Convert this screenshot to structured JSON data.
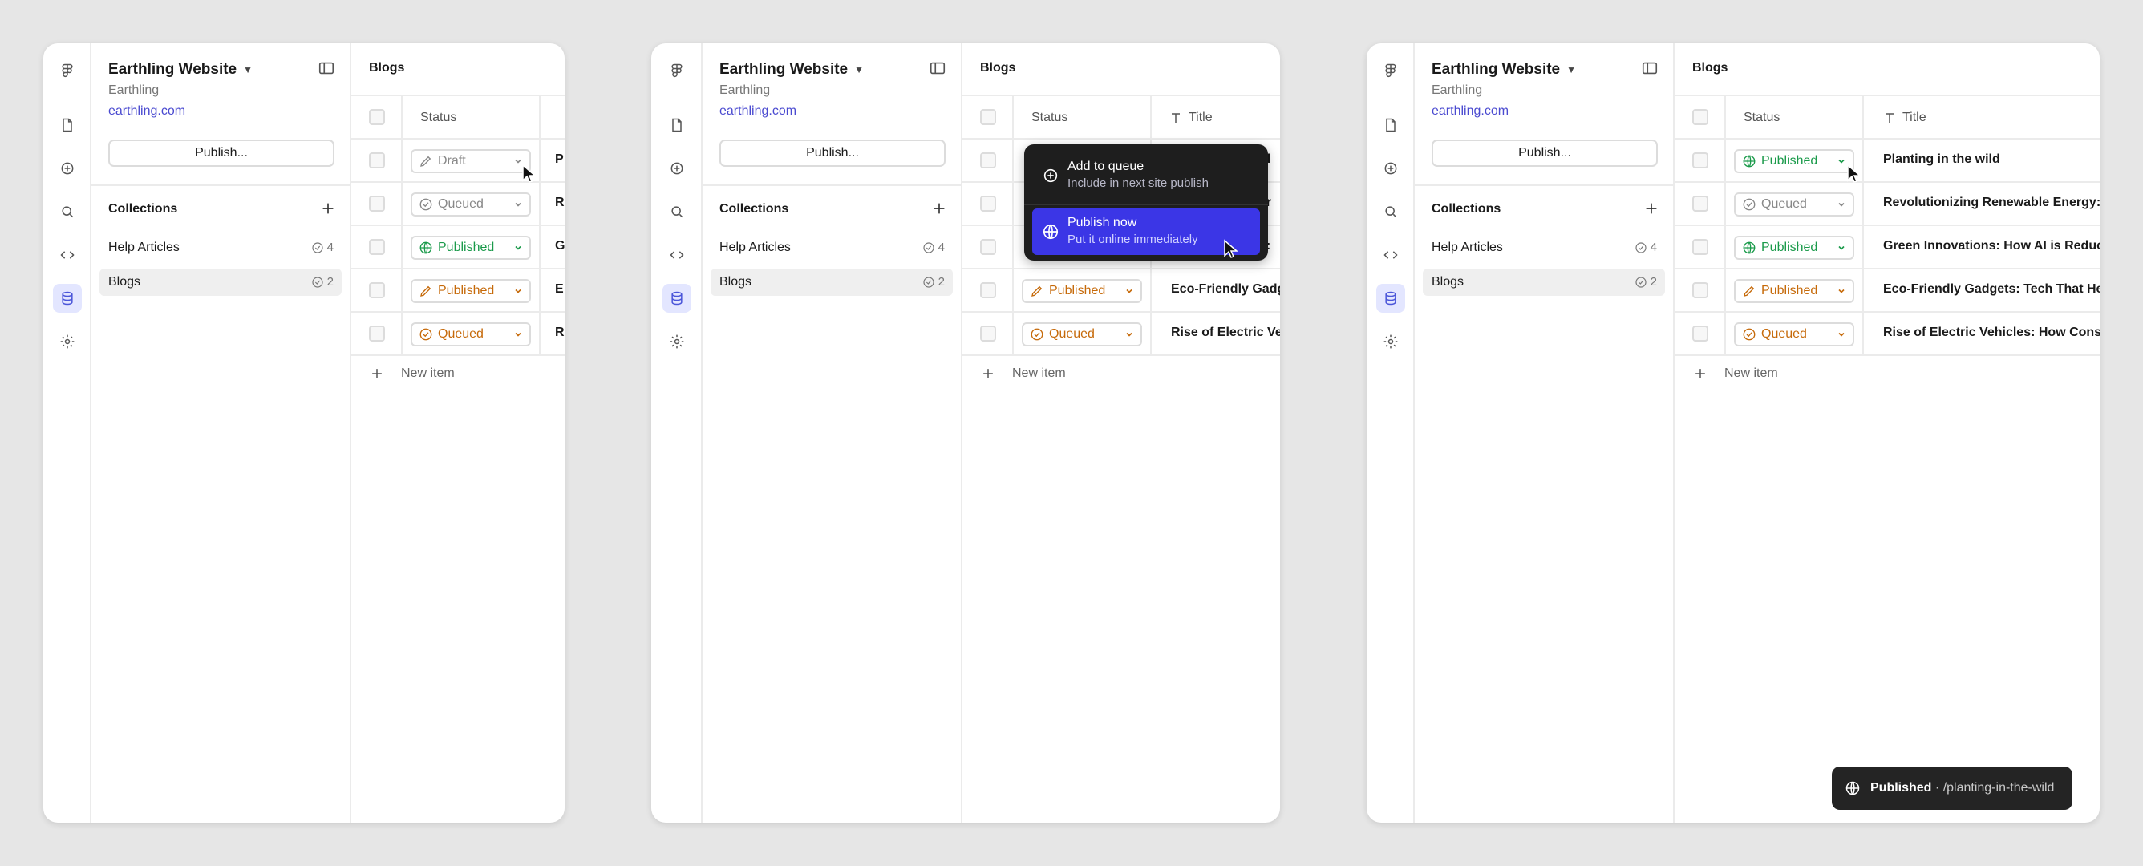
{
  "site": {
    "name": "Earthling Website",
    "subtitle": "Earthling",
    "url": "earthling.com",
    "publish_label": "Publish..."
  },
  "collections": {
    "title": "Collections",
    "items": [
      {
        "label": "Help Articles",
        "count": "4"
      },
      {
        "label": "Blogs",
        "count": "2"
      }
    ]
  },
  "table": {
    "title": "Blogs",
    "status_header": "Status",
    "title_header": "Title",
    "new_item": "New item"
  },
  "panel1": {
    "statuses": [
      "Draft",
      "Queued",
      "Published",
      "Published",
      "Queued"
    ],
    "title_initials": [
      "P",
      "R",
      "G",
      "E",
      "R"
    ]
  },
  "panel2": {
    "statuses": [
      "Published",
      "Queued"
    ],
    "titles_visible": [
      "ld",
      "er",
      "s:",
      "Eco-Friendly Gadge",
      "Rise of Electric Veh"
    ]
  },
  "panel3": {
    "statuses": [
      "Published",
      "Queued",
      "Published",
      "Published",
      "Queued"
    ],
    "titles": [
      "Planting in the wild",
      "Revolutionizing Renewable Energy: Th",
      "Green Innovations: How AI is Reducin",
      "Eco-Friendly Gadgets: Tech That Help",
      "Rise of Electric Vehicles: How Consum"
    ]
  },
  "menu": {
    "items": [
      {
        "title": "Add to queue",
        "subtitle": "Include in next site publish"
      },
      {
        "title": "Publish now",
        "subtitle": "Put it online immediately"
      }
    ]
  },
  "toast": {
    "status": "Published",
    "separator": "·",
    "slug": "/planting-in-the-wild"
  },
  "colors": {
    "accent": "#3b36e6",
    "published_green": "#1a9a4a",
    "orange": "#c66a0a",
    "link": "#4a4ad0"
  },
  "icons": [
    "figma-icon",
    "page-icon",
    "add-circle-icon",
    "search-icon",
    "code-icon",
    "database-icon",
    "gear-icon",
    "panel-toggle-icon",
    "plus-icon",
    "pencil-icon",
    "check-circle-icon",
    "globe-icon",
    "chevron-down-icon",
    "cursor-icon"
  ]
}
